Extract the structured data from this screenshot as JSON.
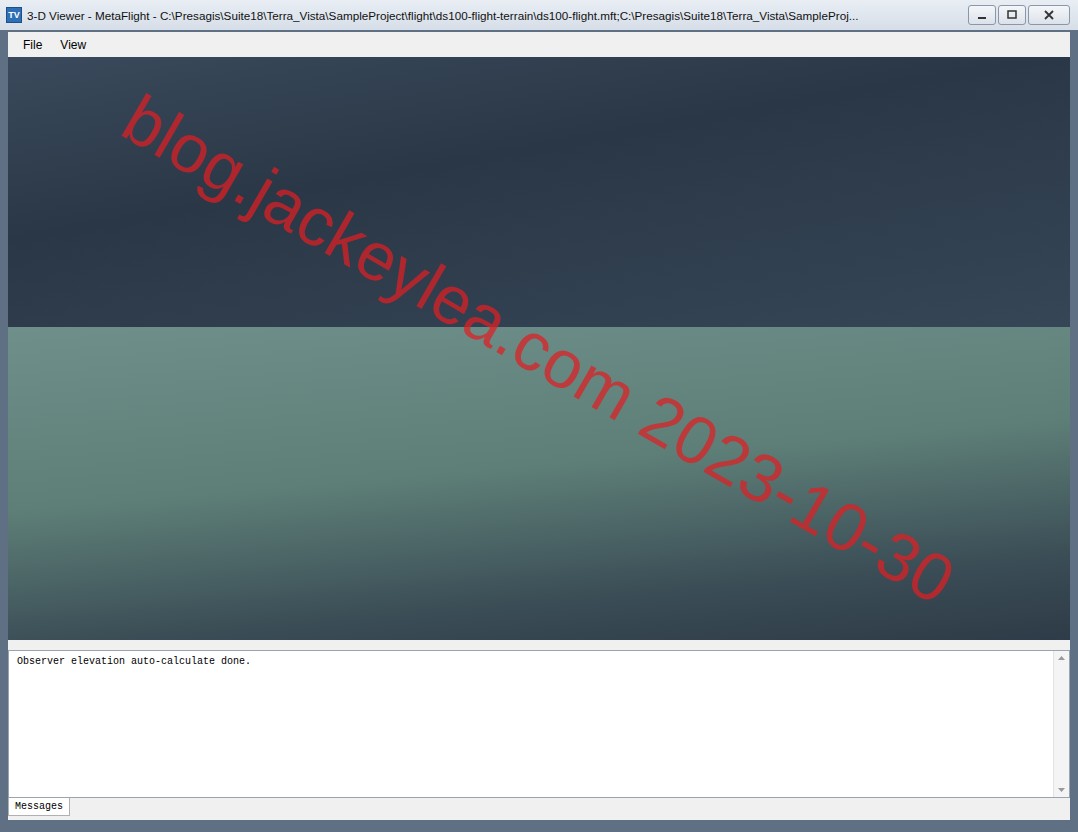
{
  "window": {
    "title": "3-D Viewer - MetaFlight - C:\\Presagis\\Suite18\\Terra_Vista\\SampleProject\\flight\\ds100-flight-terrain\\ds100-flight.mft;C:\\Presagis\\Suite18\\Terra_Vista\\SampleProj...",
    "app_icon": "TV"
  },
  "menu": [
    {
      "label": "File"
    },
    {
      "label": "View"
    }
  ],
  "watermark": "blog.jackeylea.com 2023-10-30",
  "messages": [
    "Observer elevation auto-calculate done."
  ],
  "tabs": [
    {
      "label": "Messages",
      "selected": true
    }
  ]
}
